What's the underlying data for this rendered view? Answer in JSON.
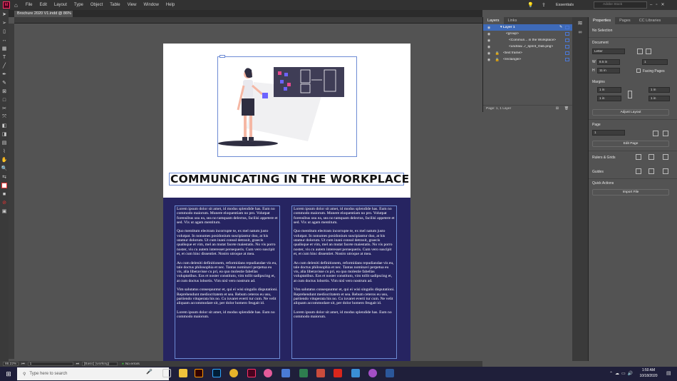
{
  "menubar": {
    "app_icon": "Id",
    "items": [
      "File",
      "Edit",
      "Layout",
      "Type",
      "Object",
      "Table",
      "View",
      "Window",
      "Help"
    ],
    "workspace": "Essentials",
    "search_placeholder": "Adobe Stock"
  },
  "document": {
    "tab_title": "Brochure 2020 V1.indd @ 86%",
    "headline": "COMMUNICATING IN THE WORKPLACE",
    "col1": [
      "Lorem ipsum dolor sit amet, id modus splendide has. Eum no commodo maiorum. Munere eloquentiam no pro. Volutpat forensibus usu ea, sea no tamquam delectus, facilisi appetere et sed. Vix ut agam mentitum.",
      "Quo mentitum electram incorrupte te, ex mel natum justo volutpat. In nonumes posidonium suscipiantur duo, at his utamur dolorum. Ut cum inani consul detraxit, graecis qualisque et vim, mel an mutat facete maiestatis. No vis porro noster, vis cu autem interesset persequeris. Cum vero suscipit et, et cum hinc dissentiet. Nostro utroque at mea.",
      "An cum deleniti definitionem, reformidans repudiandae vis eu, tale doctus philosophia et nec. Tantas nominavi perpetua eu vis, alia liberavisse cu pri, ea quo molestie fabellas voluptatibus. Eos et noster constituto, vim tollit sadipscing et, at cum doctus lobortis. Vim nisl vero nostrum ad.",
      "Vim salutatus consequuntur et, qui ei wisi singulis disputationi. Reprehendunt mediocritatem et sea. Rebum ceteros eu usu, partiendo vituperata his no. Cu iuvaret everti tur cum. Ne velit aliquam accommodare sit, per dolor homero feugait id.",
      "Lorem ipsum dolor sit amet, id modus splendide has. Eum no commodo maiorum."
    ],
    "col2": [
      "Lorem ipsum dolor sit amet, id modus splendide has. Eum no commodo maiorum. Munere eloquentiam no pro. Volutpat forensibus usu ea, sea no tamquam delectus, facilisi appetere et sed. Vix ut agam mentitum.",
      "Quo mentitum electram incorrupte te, ex mel natum justo volutpat. In nonumes posidonium suscipiantur duo, at his utamur dolorum. Ut cum inani consul detraxit, graecis qualisque et vim, mel an mutat facete maiestatis. No vis porro noster, vis cu autem interesset persequeris. Cum vero suscipit et, et cum hinc dissentiet. Nostro utroque at mea.",
      "An cum deleniti definitionem, reformidans repudiandae vis eu, tale doctus philosophia et nec. Tantas nominavi perpetua eu vis, alia liberavisse cu pri, ea quo molestie fabellas voluptatibus. Eos et noster constituto, vim tollit sadipscing et, at cum doctus lobortis. Vim nisl vero nostrum ad.",
      "Vim salutatus consequuntur et, qui ei wisi singulis disputationi. Reprehendunt mediocritatem et sea. Rebum ceteros eu usu, partiendo vituperata his no. Cu iuvaret everti tur cum. Ne velit aliquam accommodare sit, per dolor homero feugait id.",
      "Lorem ipsum dolor sit amet, id modus splendide has. Eum no commodo maiorum."
    ]
  },
  "layers": {
    "tab_layers": "Layers",
    "tab_links": "Links",
    "rows": [
      "Layer 1",
      "<group>",
      "<Commun... in the Workplace>",
      "<undraw...r_sprint_Oab.png>",
      "<text frame>",
      "<rectangle>"
    ],
    "footer": "Page: 1, 1 Layer"
  },
  "properties": {
    "tabs": [
      "Properties",
      "Pages",
      "CC Libraries"
    ],
    "selection": "No Selection",
    "document_label": "Document",
    "page_size": "Letter",
    "w": "8.5 in",
    "h": "11 in",
    "pages": "1",
    "facing_pages": "Facing Pages",
    "margins_label": "Margins",
    "m_top": "1 in",
    "m_bottom": "1 in",
    "m_left": "1 in",
    "m_right": "1 in",
    "adjust_layout": "Adjust Layout",
    "page_label": "Page",
    "page_value": "1",
    "edit_page": "Edit Page",
    "rulers_grids": "Rulers & Grids",
    "guides": "Guides",
    "quick_actions": "Quick Actions",
    "import_file": "Import File",
    "w_label": "W",
    "h_label": "H"
  },
  "status": {
    "zoom": "86.22%",
    "page": "1",
    "style": "[Basic] (working)",
    "errors": "No errors"
  },
  "taskbar": {
    "search_placeholder": "Type here to search",
    "time": "1:50 AM",
    "date": "10/18/2020"
  },
  "colors": {
    "navy": "#262461",
    "frame_blue": "#6d8bd4",
    "indesign_pink": "#ff3366"
  }
}
